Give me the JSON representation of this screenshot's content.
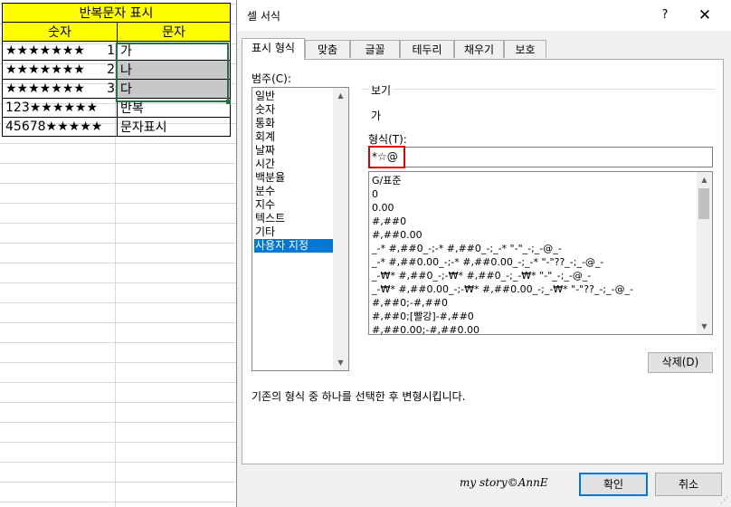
{
  "sheet": {
    "header_title": "반복문자 표시",
    "col_headers": [
      "숫자",
      "문자"
    ],
    "rows": [
      {
        "stars": "★★★★★★★",
        "num": "1",
        "text": "가"
      },
      {
        "stars": "★★★★★★★",
        "num": "2",
        "text": "나"
      },
      {
        "stars": "★★★★★★★",
        "num": "3",
        "text": "다"
      },
      {
        "left_text": "123★★★★★★",
        "text": "반복"
      },
      {
        "left_text": "45678★★★★★",
        "text": "문자표시"
      }
    ]
  },
  "dialog": {
    "title": "셀 서식",
    "help": "?",
    "close": "✕",
    "tabs": [
      "표시 형식",
      "맞춤",
      "글꼴",
      "테두리",
      "채우기",
      "보호"
    ],
    "category_label": "범주(C):",
    "categories": [
      "일반",
      "숫자",
      "통화",
      "회계",
      "날짜",
      "시간",
      "백분율",
      "분수",
      "지수",
      "텍스트",
      "기타",
      "사용자 지정"
    ],
    "selected_category": "사용자 지정",
    "sample_label": "보기",
    "sample_value": "가",
    "format_label": "형식(T):",
    "format_value": "*☆@",
    "format_list": [
      "G/표준",
      "0",
      "0.00",
      "#,##0",
      "#,##0.00",
      "_-* #,##0_-;-* #,##0_-;_-* \"-\"_-;_-@_-",
      "_-* #,##0.00_-;-* #,##0.00_-;_-* \"-\"??_-;_-@_-",
      "_-₩* #,##0_-;-₩* #,##0_-;_-₩* \"-\"_-;_-@_-",
      "_-₩* #,##0.00_-;-₩* #,##0.00_-;_-₩* \"-\"??_-;_-@_-",
      "#,##0;-#,##0",
      "#,##0;[빨강]-#,##0",
      "#,##0.00;-#,##0.00"
    ],
    "delete_label": "삭제(D)",
    "description": "기존의 형식 중 하나를 선택한 후 변형시킵니다.",
    "watermark": "my story©AnnE",
    "ok_label": "확인",
    "cancel_label": "취소"
  },
  "colors": {
    "header_fill": "#ffff00",
    "selected_cell_fill": "#c8c8c8",
    "selection_border": "#217346",
    "highlight_box": "#e00000",
    "list_selection": "#0078d7"
  }
}
